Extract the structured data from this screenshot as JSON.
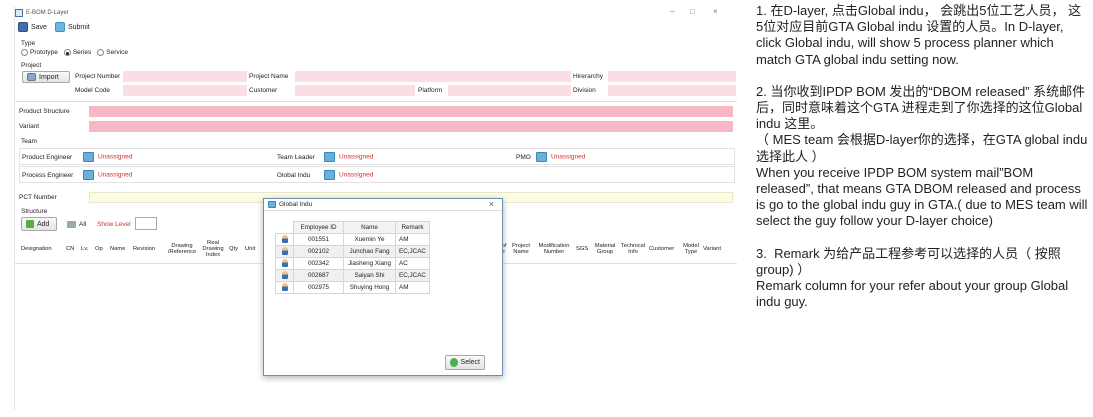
{
  "window": {
    "title": "E-BOM D-Layer",
    "min": "–",
    "max": "□",
    "close": "×"
  },
  "toolbar": {
    "save_label": "Save",
    "submit_label": "Submit"
  },
  "type": {
    "label": "Type",
    "options": [
      "Prototype",
      "Series",
      "Service"
    ],
    "selected": "Series"
  },
  "project": {
    "label": "Project",
    "import_label": "Import",
    "project_number_label": "Project Number",
    "project_name_label": "Project Name",
    "hierarchy_label": "Hirerarchy",
    "model_code_label": "Model Code",
    "customer_label": "Customer",
    "platform_label": "Platform",
    "division_label": "Division"
  },
  "product_structure_label": "Product Structure",
  "variant_label": "Variant",
  "team": {
    "label": "Team",
    "product_engineer_label": "Product Engineer",
    "team_leader_label": "Team Leader",
    "pmo_label": "PMO",
    "process_engineer_label": "Process Engineer",
    "global_indu_label": "Global Indu",
    "unassigned": "Unassigned"
  },
  "pct_number_label": "PCT Number",
  "structure": {
    "label": "Structure",
    "add_label": "Add",
    "all_label": "All",
    "show_level_label": "Show Level",
    "columns_left": [
      "Designation",
      "CN",
      "Lv.",
      "Op",
      "Name",
      "Revision",
      "Drawing /Reference",
      "Real Drawing Index",
      "Qty",
      "Unit"
    ],
    "columns_right": [
      "nd of nge",
      "Project Name",
      "Modification Number",
      "SGS",
      "Material Group",
      "Technical Info",
      "Customer",
      "Model Type",
      "Variant"
    ]
  },
  "dialog": {
    "title": "Global Indu",
    "headers": [
      "Employee ID",
      "Name",
      "Remark"
    ],
    "rows": [
      {
        "id": "001551",
        "name": "Xuemin Ye",
        "remark": "AM"
      },
      {
        "id": "002102",
        "name": "Junchao Fang",
        "remark": "EC,JCAC"
      },
      {
        "id": "002342",
        "name": "Jiasheng Xiang",
        "remark": "AC"
      },
      {
        "id": "002687",
        "name": "Saiyan Shi",
        "remark": "EC,JCAC"
      },
      {
        "id": "002975",
        "name": "Shuying Hong",
        "remark": "AM"
      }
    ],
    "close": "×",
    "select_label": "Select"
  },
  "notes": [
    "1. 在D-layer, 点击Global indu， 会跳出5位工艺人员， 这5位对应目前GTA Global indu 设置的人员。In D-layer, click Global indu, will show 5 process planner which match GTA global indu setting now.",
    "2. 当你收到IPDP BOM 发出的“DBOM released” 系统邮件后，同时意味着这个GTA 进程走到了你选择的这位Global indu 这里。\n（ MES team 会根据D-layer你的选择，在GTA global indu选择此人 ）\nWhen you receive IPDP BOM system mail”BOM released”, that means GTA DBOM released and process is go to the global indu guy in GTA.( due to MES team will select the guy follow your D-layer choice)",
    "3.  Remark 为给产品工程参考可以选择的人员（ 按照group) ）\nRemark column for your refer about your group Global indu guy."
  ]
}
